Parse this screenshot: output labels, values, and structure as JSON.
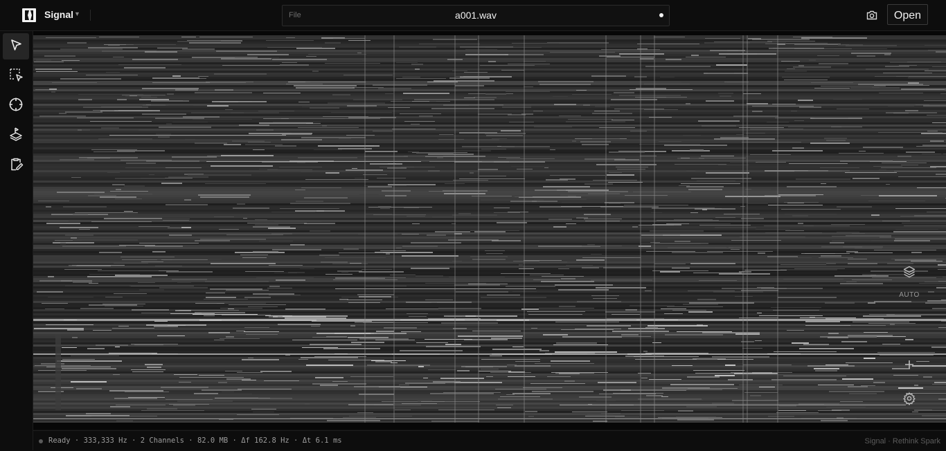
{
  "app": {
    "name": "Signal"
  },
  "file": {
    "label": "File",
    "name": "a001.wav"
  },
  "toolbar": {
    "open_label": "Open"
  },
  "tools": [
    {
      "icon": "pointer-arrow-icon"
    },
    {
      "icon": "selection-box-icon"
    },
    {
      "icon": "crosshair-icon"
    },
    {
      "icon": "layers-stack-icon"
    },
    {
      "icon": "clipboard-edit-icon"
    }
  ],
  "view_controls": {
    "auto_label": "AUTO"
  },
  "status": {
    "state": "Ready",
    "sample_rate": "333,333 Hz",
    "channels": "2 Channels",
    "size": "82.0 MB",
    "freq_resolution": "Δf 162.8 Hz",
    "time_resolution": "Δt 6.1 ms",
    "separator": " · "
  },
  "credits": {
    "text": "Signal · Rethink Spark"
  },
  "colors": {
    "background": "#0e0e0e",
    "accent": "#f0f0f0",
    "muted": "#9c9c9c"
  }
}
